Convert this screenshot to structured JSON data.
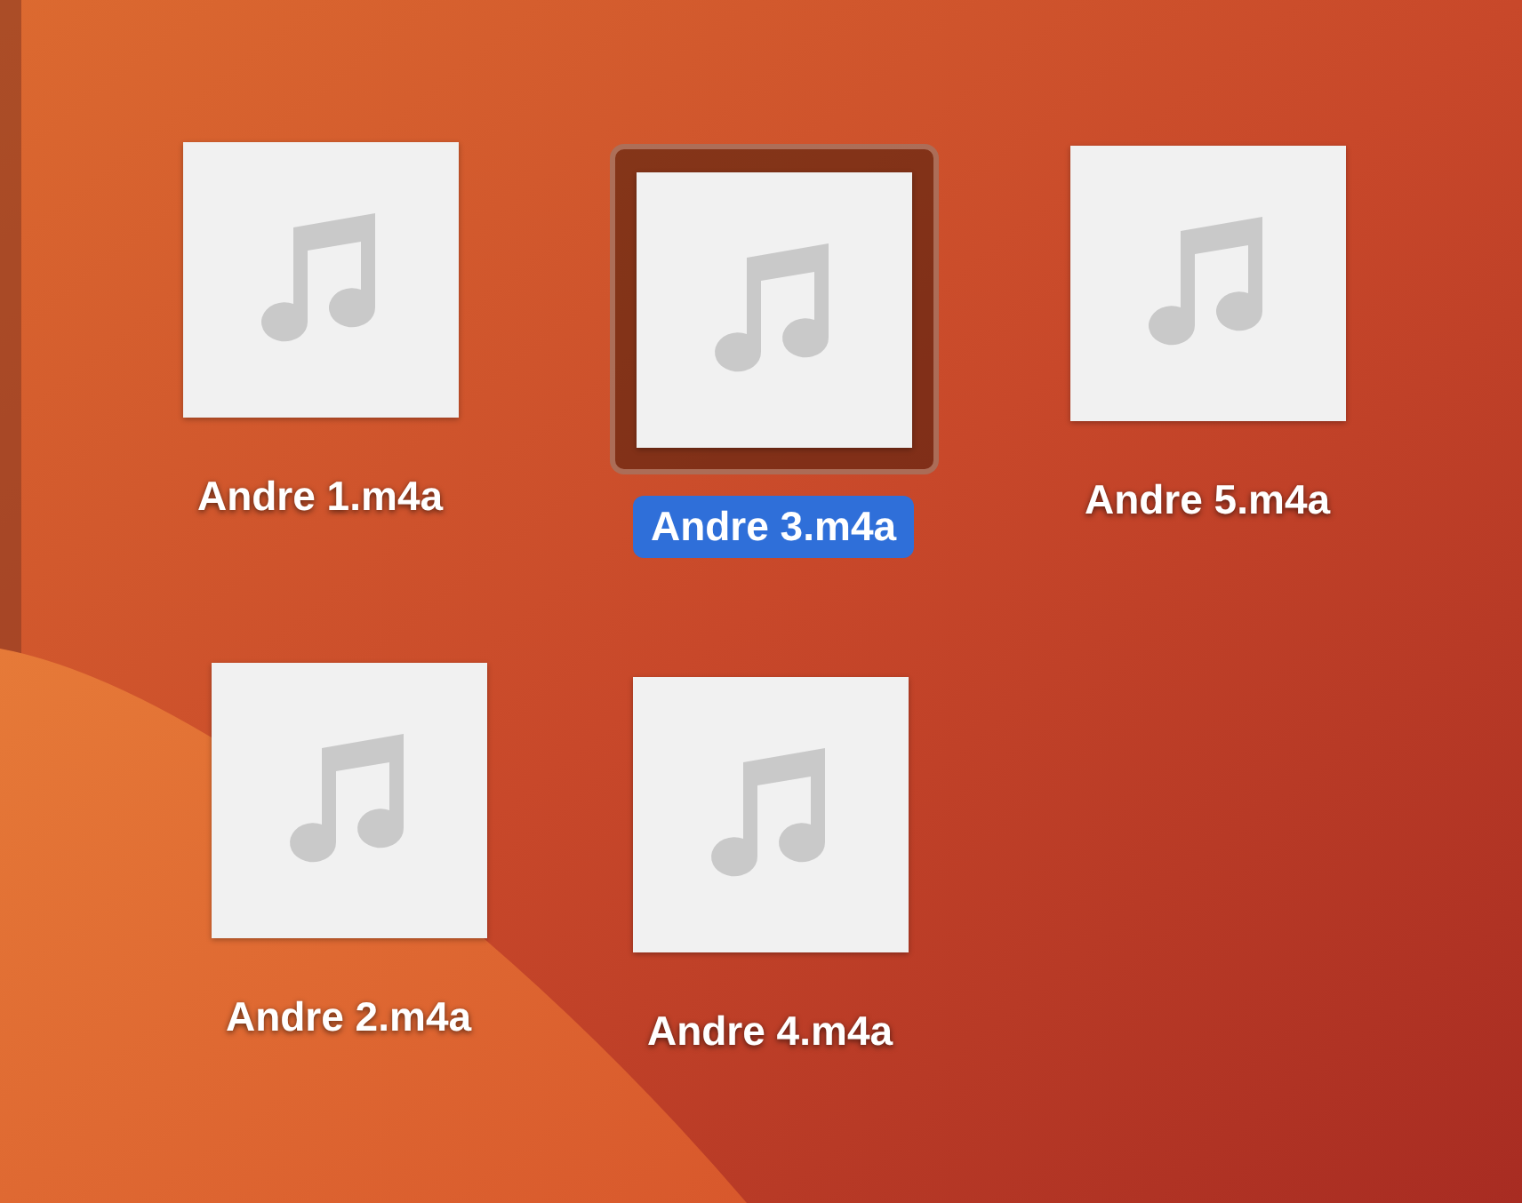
{
  "desktop_items": [
    {
      "label": "Andre 1.m4a",
      "selected": false
    },
    {
      "label": "Andre 3.m4a",
      "selected": true
    },
    {
      "label": "Andre 5.m4a",
      "selected": false
    },
    {
      "label": "Andre 2.m4a",
      "selected": false
    },
    {
      "label": "Andre 4.m4a",
      "selected": false
    }
  ]
}
